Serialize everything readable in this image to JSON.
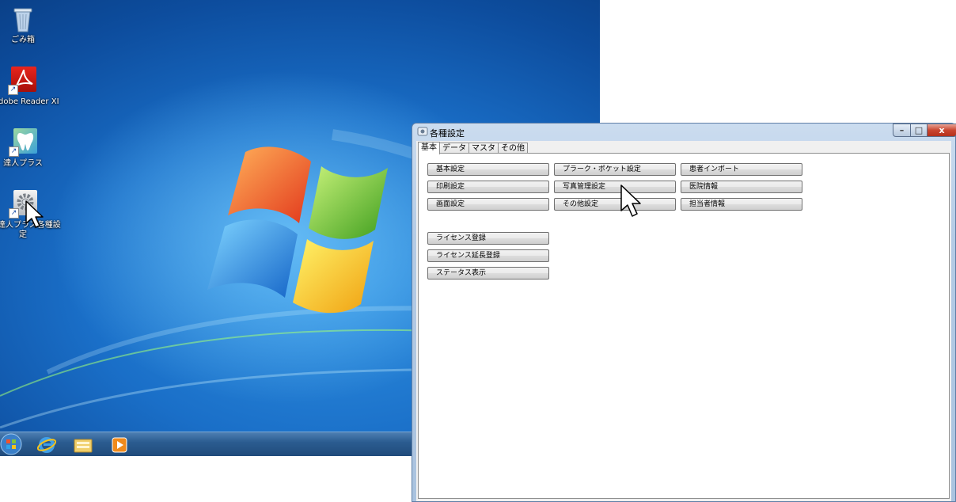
{
  "desktop": {
    "icons": [
      {
        "label": "ごみ箱",
        "icon": "recycle-bin-icon"
      },
      {
        "label": "dobe Reader XI",
        "icon": "adobe-reader-icon"
      },
      {
        "label": "達人プラス",
        "icon": "tooth-app-icon"
      },
      {
        "label_line1": "達人プラス各種設",
        "label_line2": "定",
        "icon": "gear-settings-icon"
      }
    ]
  },
  "taskbar": {
    "items": [
      "start-orb-icon",
      "internet-explorer-icon",
      "file-explorer-icon",
      "media-player-icon"
    ]
  },
  "window": {
    "title": "各種設定",
    "tabs": [
      {
        "label": "基本",
        "active": true
      },
      {
        "label": "データ"
      },
      {
        "label": "マスタ"
      },
      {
        "label": "その他"
      }
    ],
    "buttons": {
      "col1": [
        "基本設定",
        "印刷設定",
        "画面設定"
      ],
      "col2": [
        "プラーク・ポケット設定",
        "写真管理設定",
        "その他設定"
      ],
      "col3": [
        "患者インポート",
        "医院情報",
        "担当者情報"
      ],
      "license": [
        "ライセンス登録",
        "ライセンス延長登録",
        "ステータス表示"
      ]
    },
    "controls": {
      "minimize": "–",
      "maximize": "□",
      "close": "x"
    }
  },
  "colors": {
    "desktop_blue": "#1a6fc8",
    "window_frame": "#b4cbe5",
    "close_red": "#c9462f"
  }
}
